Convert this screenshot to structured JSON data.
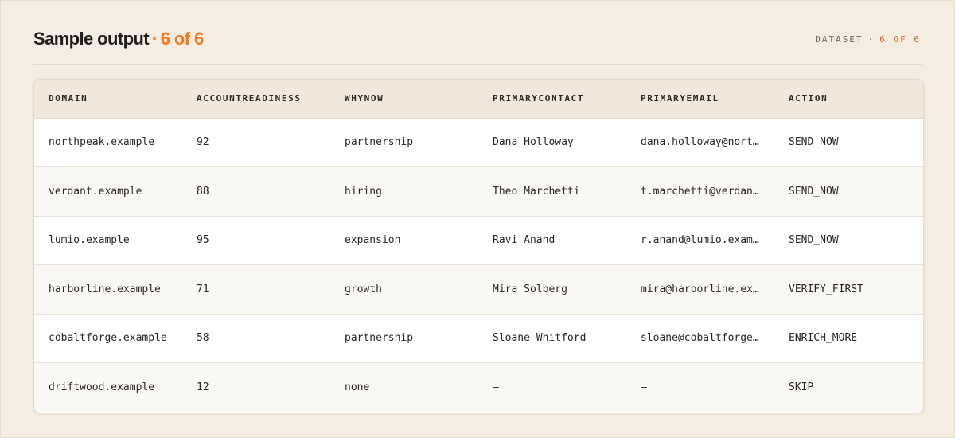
{
  "header": {
    "title": "Sample output",
    "separator": "·",
    "count": "6 of 6",
    "badge_label": "DATASET",
    "badge_separator": "·",
    "badge_count": "6 OF 6"
  },
  "table": {
    "columns": [
      "DOMAIN",
      "ACCOUNTREADINESS",
      "WHYNOW",
      "PRIMARYCONTACT",
      "PRIMARYEMAIL",
      "ACTION"
    ],
    "rows": [
      [
        "northpeak.example",
        "92",
        "partnership",
        "Dana Holloway",
        "dana.holloway@northpeak.example",
        "SEND_NOW"
      ],
      [
        "verdant.example",
        "88",
        "hiring",
        "Theo Marchetti",
        "t.marchetti@verdant.example",
        "SEND_NOW"
      ],
      [
        "lumio.example",
        "95",
        "expansion",
        "Ravi Anand",
        "r.anand@lumio.example",
        "SEND_NOW"
      ],
      [
        "harborline.example",
        "71",
        "growth",
        "Mira Solberg",
        "mira@harborline.example",
        "VERIFY_FIRST"
      ],
      [
        "cobaltforge.example",
        "58",
        "partnership",
        "Sloane Whitford",
        "sloane@cobaltforge.example",
        "ENRICH_MORE"
      ],
      [
        "driftwood.example",
        "12",
        "none",
        "—",
        "—",
        "SKIP"
      ]
    ]
  },
  "colors": {
    "background": "#f5ede2",
    "accent": "#f07a22",
    "header_row": "#f1e8db"
  }
}
